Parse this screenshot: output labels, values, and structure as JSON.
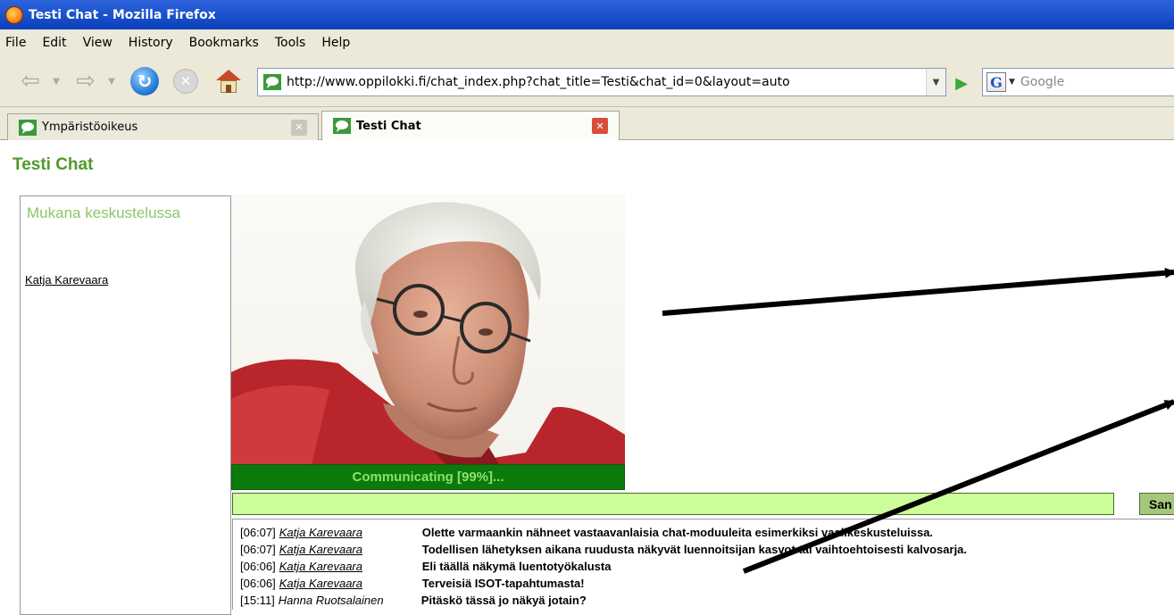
{
  "window": {
    "title": "Testi Chat - Mozilla Firefox"
  },
  "menu": [
    "File",
    "Edit",
    "View",
    "History",
    "Bookmarks",
    "Tools",
    "Help"
  ],
  "nav": {
    "url": "http://www.oppilokki.fi/chat_index.php?chat_title=Testi&chat_id=0&layout=auto",
    "search_placeholder": "Google"
  },
  "tabs": [
    {
      "label": "Ympäristöoikeus",
      "active": false
    },
    {
      "label": "Testi Chat",
      "active": true
    }
  ],
  "page": {
    "title": "Testi Chat",
    "participants_heading": "Mukana keskustelussa",
    "participants": [
      "Katja Karevaara"
    ],
    "status": "Communicating [99%]...",
    "send_label": "San",
    "messages": [
      {
        "time": "[06:07]",
        "user": "Katja Karevaara",
        "text": "Olette varmaankin nähneet vastaavanlaisia chat-moduuleita esimerkiksi vaalikeskusteluissa."
      },
      {
        "time": "[06:07]",
        "user": "Katja Karevaara",
        "text": "Todellisen lähetyksen aikana ruudusta näkyvät luennoitsijan kasvot tai vaihtoehtoisesti kalvosarja."
      },
      {
        "time": "[06:06]",
        "user": "Katja Karevaara",
        "text": "Eli täällä näkymä luentotyökalusta"
      },
      {
        "time": "[06:06]",
        "user": "Katja Karevaara",
        "text": "Terveisiä ISOT-tapahtumasta!"
      },
      {
        "time": "[15:11]",
        "user": "Hanna Ruotsalainen",
        "text": "Pitäskö tässä jo näkyä jotain?"
      }
    ]
  },
  "colors": {
    "accent_green": "#4f9a2a",
    "status_bg": "#0b7a0b",
    "input_bg": "#ccff99",
    "titlebar": "#1f56d0"
  },
  "icons": [
    "firefox-icon",
    "back-icon",
    "forward-icon",
    "reload-icon",
    "stop-icon",
    "home-icon",
    "go-icon",
    "google-icon",
    "tab-close-icon"
  ]
}
